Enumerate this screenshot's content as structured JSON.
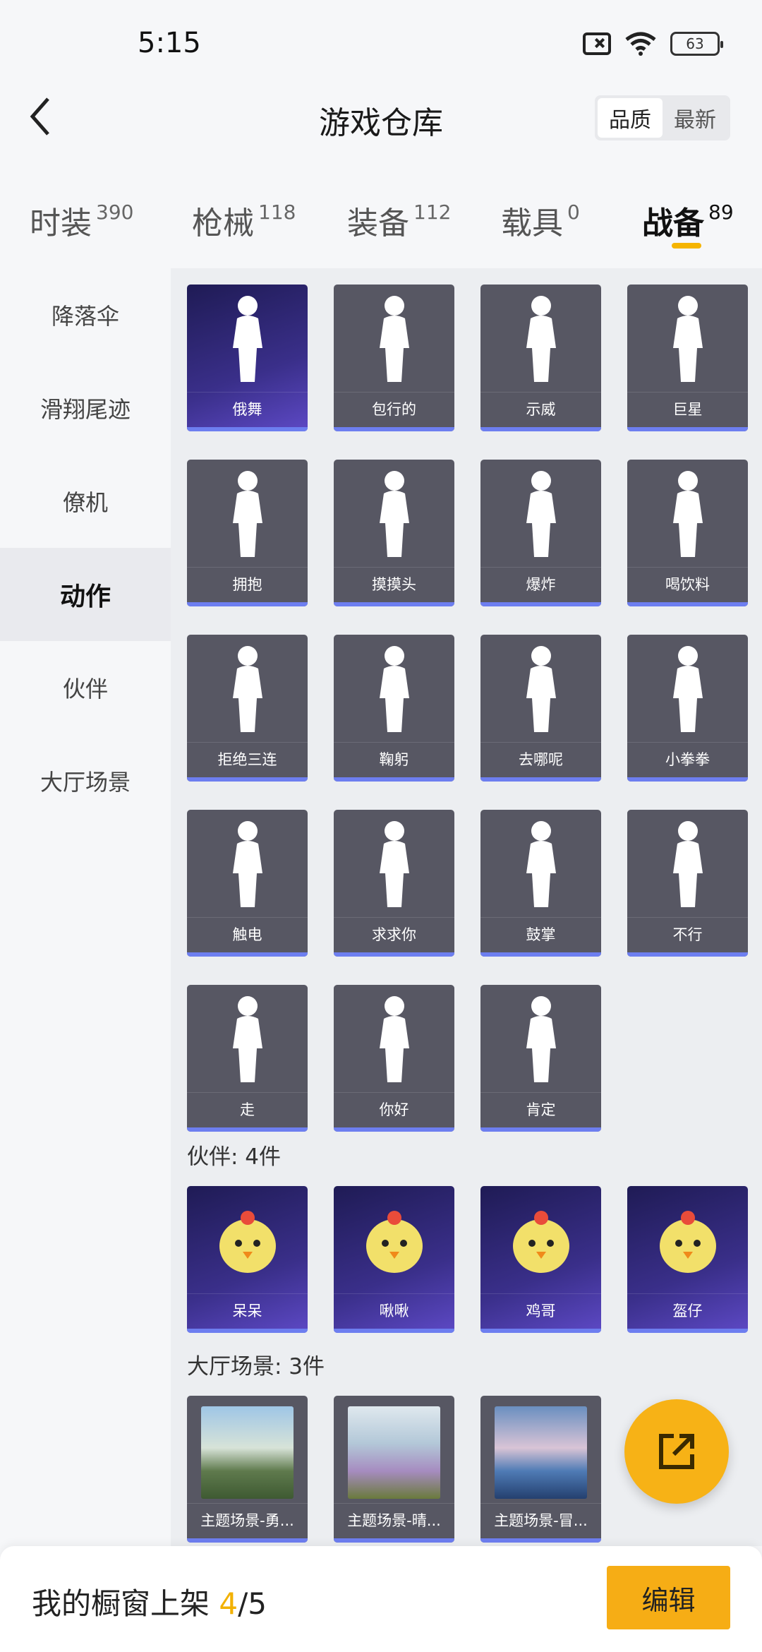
{
  "status": {
    "time": "5:15",
    "battery": "63"
  },
  "header": {
    "title": "游戏仓库",
    "sort_options": [
      "品质",
      "最新"
    ]
  },
  "tabs": [
    {
      "label": "时装",
      "count": "390"
    },
    {
      "label": "枪械",
      "count": "118"
    },
    {
      "label": "装备",
      "count": "112"
    },
    {
      "label": "载具",
      "count": "0"
    },
    {
      "label": "战备",
      "count": "89",
      "active": true
    }
  ],
  "sidebar": {
    "items": [
      "降落伞",
      "滑翔尾迹",
      "僚机",
      "动作",
      "伙伴",
      "大厅场景"
    ],
    "active": "动作"
  },
  "emotes": [
    "俄舞",
    "包行的",
    "示威",
    "巨星",
    "拥抱",
    "摸摸头",
    "爆炸",
    "喝饮料",
    "拒绝三连",
    "鞠躬",
    "去哪呢",
    "小拳拳",
    "触电",
    "求求你",
    "鼓掌",
    "不行",
    "走",
    "你好",
    "肯定"
  ],
  "partners": {
    "title": "伙伴: 4件",
    "items": [
      "呆呆",
      "啾啾",
      "鸡哥",
      "盔仔"
    ]
  },
  "scenes": {
    "title": "大厅场景: 3件",
    "items": [
      "主题场景-勇...",
      "主题场景-晴...",
      "主题场景-冒..."
    ]
  },
  "bottom": {
    "shelf_label": "我的橱窗上架 ",
    "shelf_current": "4",
    "shelf_total": "/5",
    "edit_label": "编辑"
  },
  "colors": {
    "accent": "#f6ad15",
    "card": "#575763",
    "card_bar": "#6d7ef0"
  }
}
